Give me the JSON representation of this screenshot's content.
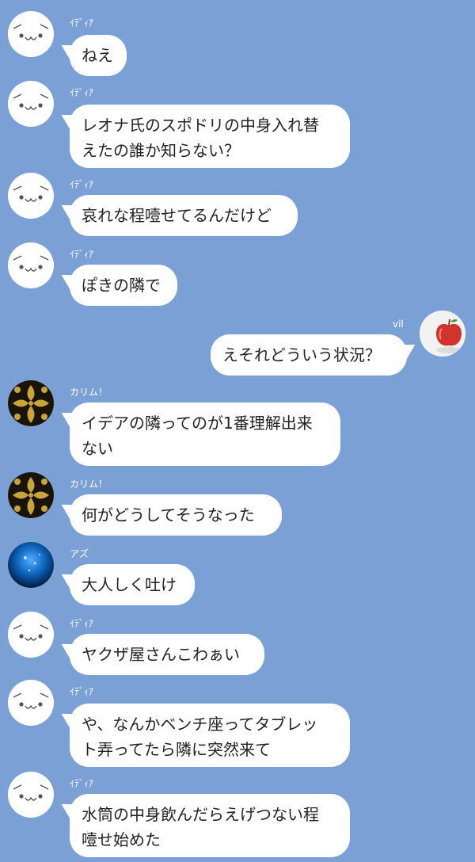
{
  "colors": {
    "background": "#7aa0d5",
    "bubble": "#ffffff",
    "text": "#222222",
    "sender": "#ffffff"
  },
  "messages": [
    {
      "sender": "ｲﾃﾞｨｱ",
      "text": "ねえ",
      "avatar": "idia-face-icon"
    },
    {
      "sender": "ｲﾃﾞｨｱ",
      "text": "レオナ氏のスポドリの中身入れ替\nえたの誰か知らない？",
      "avatar": "idia-face-icon"
    },
    {
      "sender": "ｲﾃﾞｨｱ",
      "text": "哀れな程噎せてるんだけど",
      "avatar": "idia-face-icon"
    },
    {
      "sender": "ｲﾃﾞｨｱ",
      "text": "ぽきの隣で",
      "avatar": "idia-face-icon"
    },
    {
      "sender": "vil",
      "text": "えそれどういう状況？",
      "avatar": "apple-icon"
    },
    {
      "sender": "カリム！",
      "text": "イデアの隣ってのが1番理解出来\nない",
      "avatar": "gold-damask-icon"
    },
    {
      "sender": "カリム！",
      "text": "何がどうしてそうなった",
      "avatar": "gold-damask-icon"
    },
    {
      "sender": "アズ",
      "text": "大人しく吐け",
      "avatar": "blue-ocean-icon"
    },
    {
      "sender": "ｲﾃﾞｨｱ",
      "text": "ヤクザ屋さんこわぁい",
      "avatar": "idia-face-icon"
    },
    {
      "sender": "ｲﾃﾞｨｱ",
      "text": "や、なんかベンチ座ってタブレッ\nト弄ってたら隣に突然来て",
      "avatar": "idia-face-icon"
    },
    {
      "sender": "ｲﾃﾞｨｱ",
      "text": "水筒の中身飲んだらえげつない程\n噎せ始めた",
      "avatar": "idia-face-icon"
    }
  ]
}
